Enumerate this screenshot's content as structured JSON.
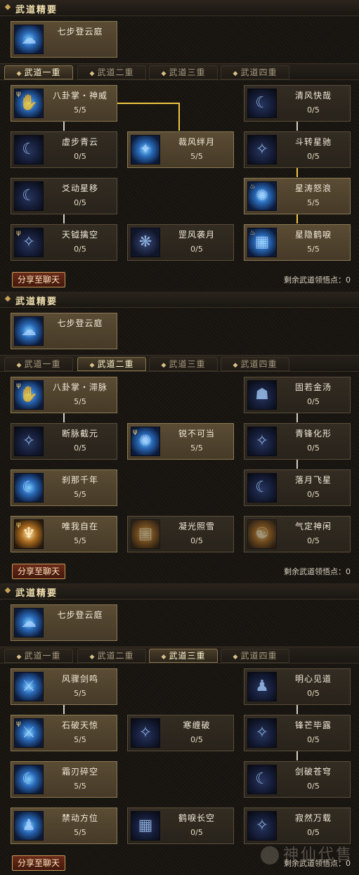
{
  "panels": [
    {
      "section_title": "武道精要",
      "essence": {
        "name": "七步登云庭",
        "icon": "ascend-cloud-icon"
      },
      "tabs": [
        "武道一重",
        "武道二重",
        "武道三重",
        "武道四重"
      ],
      "active_tab": 0,
      "nodes": [
        {
          "name": "八卦掌・神威",
          "level": "5/5",
          "lit": true,
          "icon": "palm-strike-icon"
        },
        {
          "name": "清风快哉",
          "level": "0/5",
          "lit": false,
          "icon": "breeze-icon"
        },
        {
          "name": "虚步青云",
          "level": "0/5",
          "lit": false,
          "icon": "cloud-step-icon"
        },
        {
          "name": "裁风绊月",
          "level": "5/5",
          "lit": true,
          "icon": "wind-moon-icon"
        },
        {
          "name": "斗转星驰",
          "level": "0/5",
          "lit": false,
          "icon": "star-dash-icon"
        },
        {
          "name": "爻动星移",
          "level": "0/5",
          "lit": false,
          "icon": "star-shift-icon"
        },
        {
          "name": "星涛怒浪",
          "level": "5/5",
          "lit": true,
          "icon": "star-wave-icon"
        },
        {
          "name": "天钺擒空",
          "level": "0/5",
          "lit": false,
          "icon": "sky-axe-icon"
        },
        {
          "name": "罡风袭月",
          "level": "0/5",
          "lit": false,
          "icon": "gale-moon-icon"
        },
        {
          "name": "星隐鹤唳",
          "level": "5/5",
          "lit": true,
          "icon": "crane-cry-icon"
        }
      ],
      "share_button": "分享至聊天",
      "points_label": "剩余武道领悟点：",
      "points_value": "0"
    },
    {
      "section_title": "武道精要",
      "essence": {
        "name": "七步登云庭",
        "icon": "ascend-cloud-icon"
      },
      "tabs": [
        "武道一重",
        "武道二重",
        "武道三重",
        "武道四重"
      ],
      "active_tab": 1,
      "nodes": [
        {
          "name": "八卦掌・滞脉",
          "level": "5/5",
          "lit": true,
          "icon": "palm-strike-icon"
        },
        {
          "name": "固若金汤",
          "level": "0/5",
          "lit": false,
          "icon": "fortress-icon"
        },
        {
          "name": "断脉截元",
          "level": "0/5",
          "lit": false,
          "icon": "meridian-cut-icon"
        },
        {
          "name": "锐不可当",
          "level": "5/5",
          "lit": true,
          "icon": "unstoppable-icon"
        },
        {
          "name": "青锋化形",
          "level": "0/5",
          "lit": false,
          "icon": "blade-form-icon"
        },
        {
          "name": "刹那千年",
          "level": "5/5",
          "lit": true,
          "icon": "instant-icon"
        },
        {
          "name": "落月飞星",
          "level": "0/5",
          "lit": false,
          "icon": "falling-moon-icon"
        },
        {
          "name": "唯我自在",
          "level": "5/5",
          "lit": true,
          "icon": "freedom-icon"
        },
        {
          "name": "凝光照雪",
          "level": "0/5",
          "lit": false,
          "icon": "light-snow-icon"
        },
        {
          "name": "气定神闲",
          "level": "0/5",
          "lit": false,
          "icon": "calm-mind-icon"
        }
      ],
      "share_button": "分享至聊天",
      "points_label": "剩余武道领悟点：",
      "points_value": "0"
    },
    {
      "section_title": "武道精要",
      "essence": {
        "name": "七步登云庭",
        "icon": "ascend-cloud-icon"
      },
      "tabs": [
        "武道一重",
        "武道二重",
        "武道三重",
        "武道四重"
      ],
      "active_tab": 2,
      "nodes": [
        {
          "name": "风骤剑鸣",
          "level": "5/5",
          "lit": true,
          "icon": "wind-sword-icon"
        },
        {
          "name": "明心见道",
          "level": "0/5",
          "lit": false,
          "icon": "clear-heart-icon"
        },
        {
          "name": "石破天惊",
          "level": "5/5",
          "lit": true,
          "icon": "stone-break-icon"
        },
        {
          "name": "寒缠破",
          "level": "0/5",
          "lit": false,
          "icon": "frost-bind-icon"
        },
        {
          "name": "锋芒毕露",
          "level": "0/5",
          "lit": false,
          "icon": "sharp-edge-icon"
        },
        {
          "name": "霜刃碎空",
          "level": "5/5",
          "lit": true,
          "icon": "frost-blade-icon"
        },
        {
          "name": "剑破苍穹",
          "level": "0/5",
          "lit": false,
          "icon": "sky-pierce-icon"
        },
        {
          "name": "禁动方位",
          "level": "5/5",
          "lit": true,
          "icon": "lockdown-icon"
        },
        {
          "name": "鹤唳长空",
          "level": "0/5",
          "lit": false,
          "icon": "crane-sky-icon"
        },
        {
          "name": "寂然万载",
          "level": "0/5",
          "lit": false,
          "icon": "silence-icon"
        }
      ],
      "share_button": "分享至聊天",
      "points_label": "剩余武道领悟点：",
      "points_value": "0"
    }
  ],
  "watermark": "神仙代售"
}
